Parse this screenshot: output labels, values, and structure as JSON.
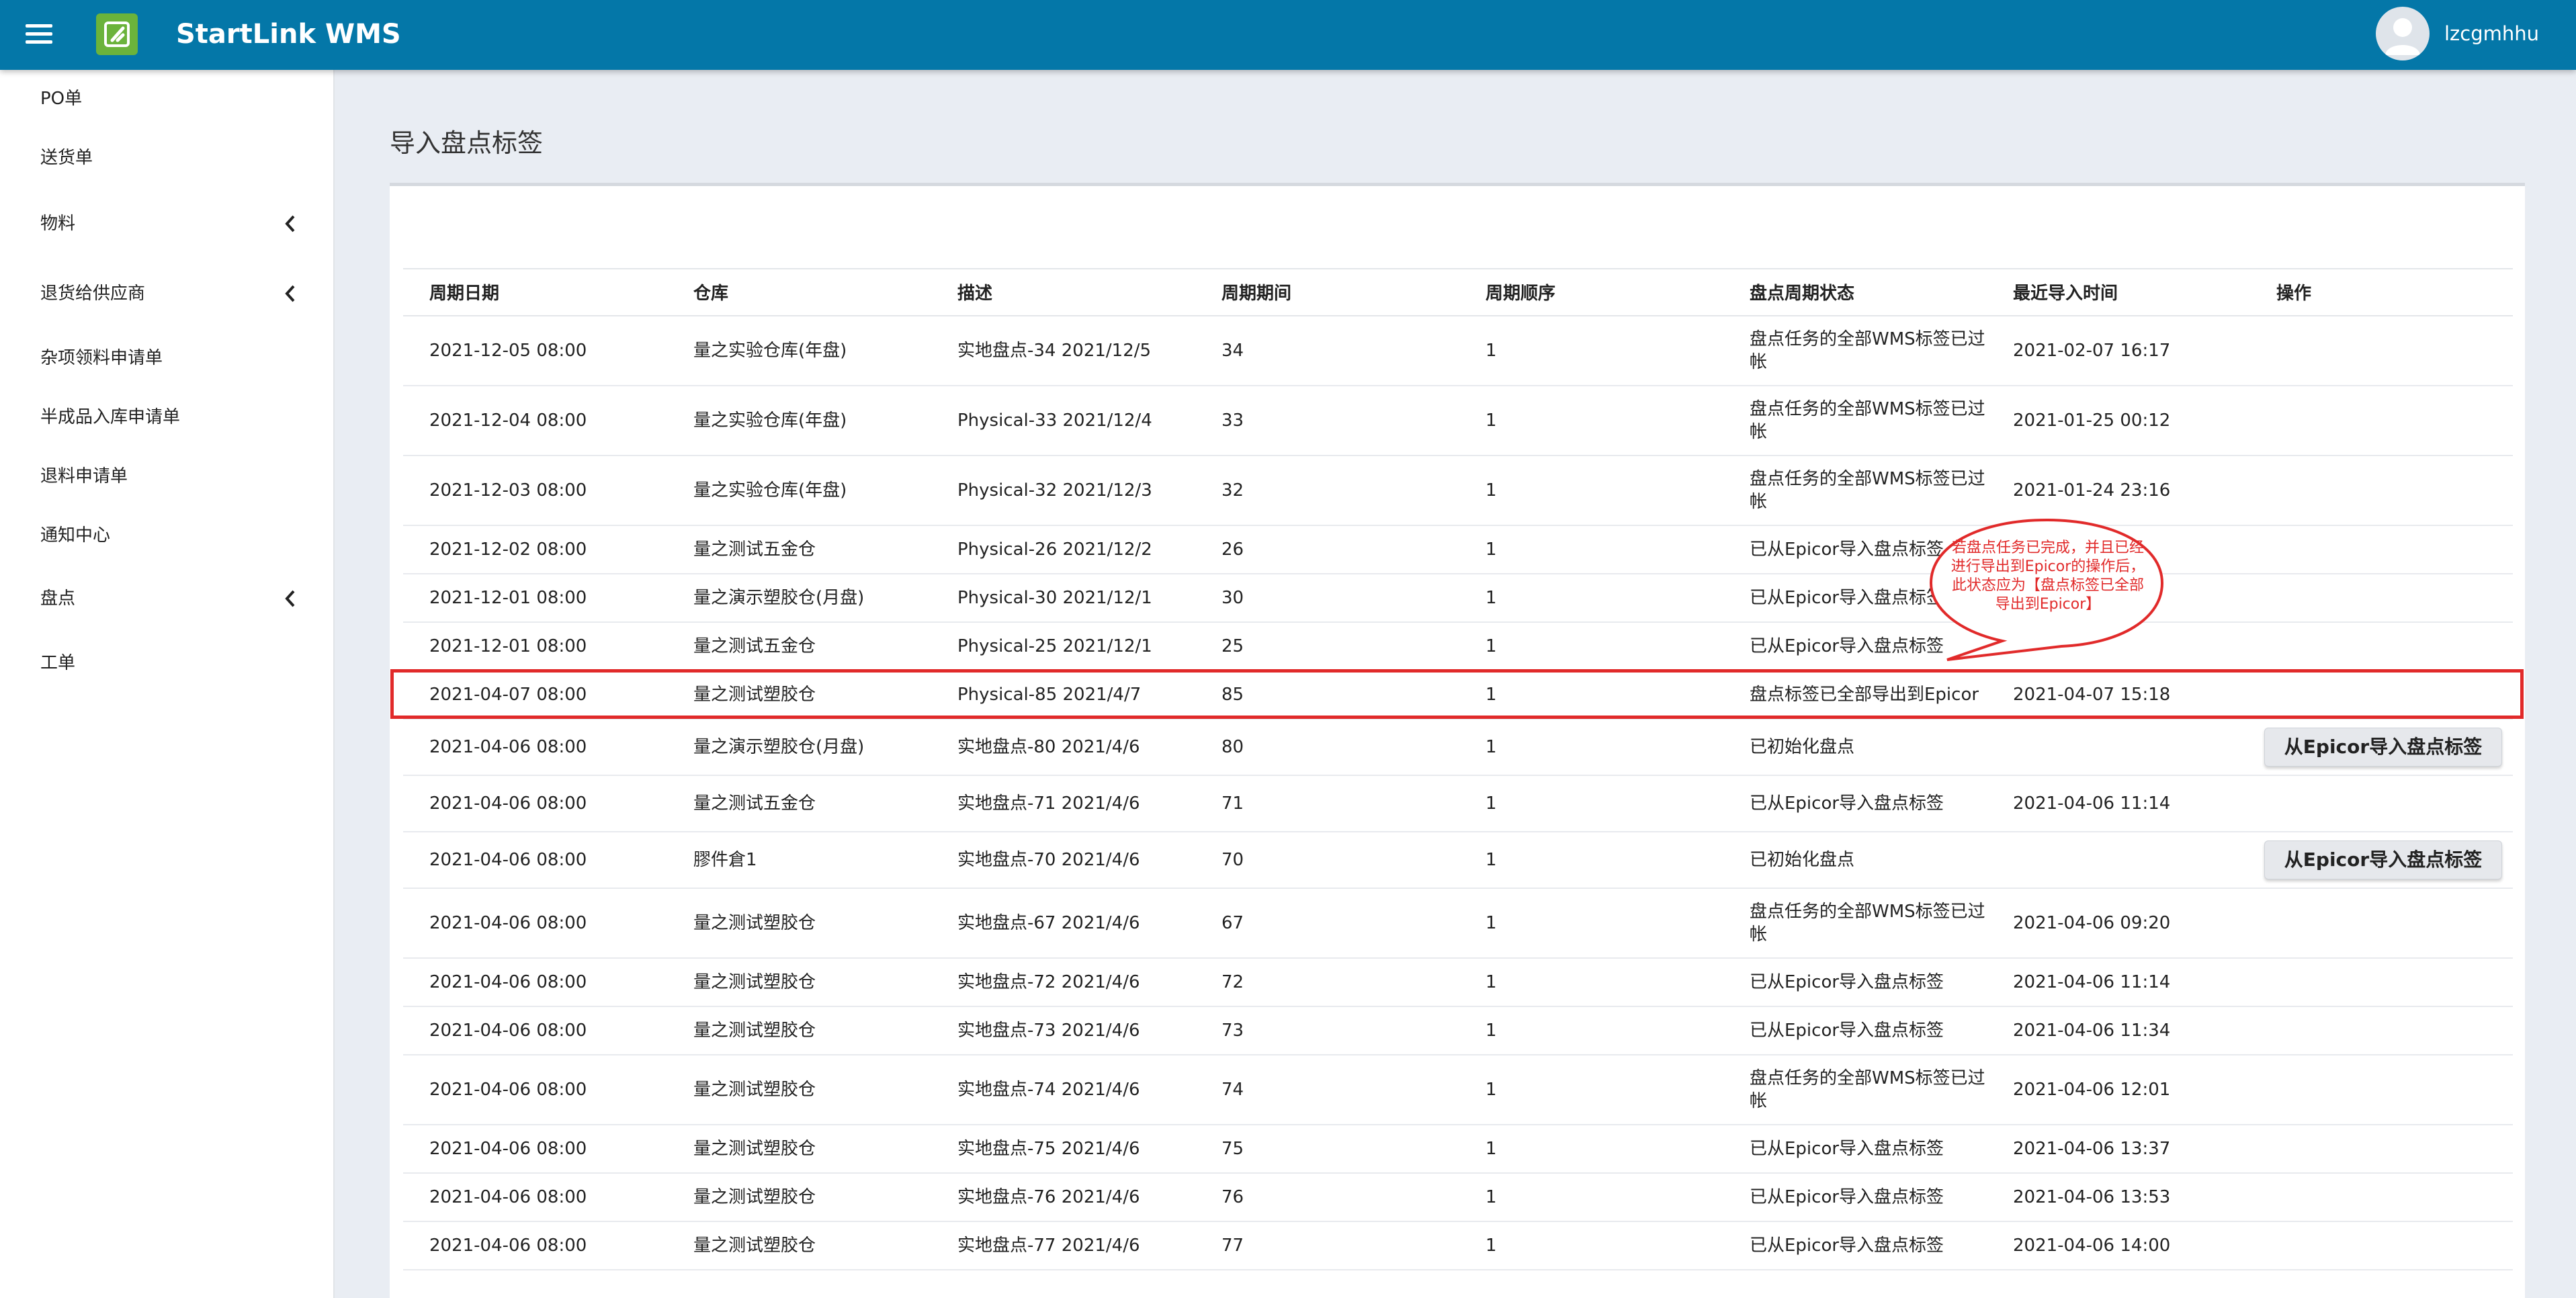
{
  "header": {
    "app_title": "StartLink WMS",
    "username": "lzcgmhhu"
  },
  "sidebar": {
    "items": [
      {
        "label": "PO单",
        "has_chevron": false
      },
      {
        "label": "送货单",
        "has_chevron": false
      },
      {
        "label": "物料",
        "has_chevron": true
      },
      {
        "label": "退货给供应商",
        "has_chevron": true
      },
      {
        "label": "杂项领料申请单",
        "has_chevron": false
      },
      {
        "label": "半成品入库申请单",
        "has_chevron": false
      },
      {
        "label": "退料申请单",
        "has_chevron": false
      },
      {
        "label": "通知中心",
        "has_chevron": false
      },
      {
        "label": "盘点",
        "has_chevron": true
      },
      {
        "label": "工单",
        "has_chevron": false
      }
    ]
  },
  "page": {
    "title": "导入盘点标签"
  },
  "table": {
    "columns": [
      "周期日期",
      "仓库",
      "描述",
      "周期期间",
      "周期顺序",
      "盘点周期状态",
      "最近导入时间",
      "操作"
    ],
    "rows": [
      {
        "date": "2021-12-05 08:00",
        "warehouse": "量之实验仓库(年盘)",
        "desc": "实地盘点-34 2021/12/5",
        "period": "34",
        "seq": "1",
        "status": "盘点任务的全部WMS标签已过帐",
        "imported": "2021-02-07 16:17",
        "action": ""
      },
      {
        "date": "2021-12-04 08:00",
        "warehouse": "量之实验仓库(年盘)",
        "desc": "Physical-33 2021/12/4",
        "period": "33",
        "seq": "1",
        "status": "盘点任务的全部WMS标签已过帐",
        "imported": "2021-01-25 00:12",
        "action": ""
      },
      {
        "date": "2021-12-03 08:00",
        "warehouse": "量之实验仓库(年盘)",
        "desc": "Physical-32 2021/12/3",
        "period": "32",
        "seq": "1",
        "status": "盘点任务的全部WMS标签已过帐",
        "imported": "2021-01-24 23:16",
        "action": ""
      },
      {
        "date": "2021-12-02 08:00",
        "warehouse": "量之测试五金仓",
        "desc": "Physical-26 2021/12/2",
        "period": "26",
        "seq": "1",
        "status": "已从Epicor导入盘点标签",
        "imported": "",
        "action": ""
      },
      {
        "date": "2021-12-01 08:00",
        "warehouse": "量之演示塑胶仓(月盘)",
        "desc": "Physical-30 2021/12/1",
        "period": "30",
        "seq": "1",
        "status": "已从Epicor导入盘点标签",
        "imported": "",
        "action": ""
      },
      {
        "date": "2021-12-01 08:00",
        "warehouse": "量之测试五金仓",
        "desc": "Physical-25 2021/12/1",
        "period": "25",
        "seq": "1",
        "status": "已从Epicor导入盘点标签",
        "imported": "",
        "action": ""
      },
      {
        "date": "2021-04-07 08:00",
        "warehouse": "量之测试塑胶仓",
        "desc": "Physical-85 2021/4/7",
        "period": "85",
        "seq": "1",
        "status": "盘点标签已全部导出到Epicor",
        "imported": "2021-04-07 15:18",
        "action": ""
      },
      {
        "date": "2021-04-06 08:00",
        "warehouse": "量之演示塑胶仓(月盘)",
        "desc": "实地盘点-80 2021/4/6",
        "period": "80",
        "seq": "1",
        "status": "已初始化盘点",
        "imported": "",
        "action": "从Epicor导入盘点标签"
      },
      {
        "date": "2021-04-06 08:00",
        "warehouse": "量之测试五金仓",
        "desc": "实地盘点-71 2021/4/6",
        "period": "71",
        "seq": "1",
        "status": "已从Epicor导入盘点标签",
        "imported": "2021-04-06 11:14",
        "action": ""
      },
      {
        "date": "2021-04-06 08:00",
        "warehouse": "膠件倉1",
        "desc": "实地盘点-70 2021/4/6",
        "period": "70",
        "seq": "1",
        "status": "已初始化盘点",
        "imported": "",
        "action": "从Epicor导入盘点标签"
      },
      {
        "date": "2021-04-06 08:00",
        "warehouse": "量之测试塑胶仓",
        "desc": "实地盘点-67 2021/4/6",
        "period": "67",
        "seq": "1",
        "status": "盘点任务的全部WMS标签已过帐",
        "imported": "2021-04-06 09:20",
        "action": ""
      },
      {
        "date": "2021-04-06 08:00",
        "warehouse": "量之测试塑胶仓",
        "desc": "实地盘点-72 2021/4/6",
        "period": "72",
        "seq": "1",
        "status": "已从Epicor导入盘点标签",
        "imported": "2021-04-06 11:14",
        "action": ""
      },
      {
        "date": "2021-04-06 08:00",
        "warehouse": "量之测试塑胶仓",
        "desc": "实地盘点-73 2021/4/6",
        "period": "73",
        "seq": "1",
        "status": "已从Epicor导入盘点标签",
        "imported": "2021-04-06 11:34",
        "action": ""
      },
      {
        "date": "2021-04-06 08:00",
        "warehouse": "量之测试塑胶仓",
        "desc": "实地盘点-74 2021/4/6",
        "period": "74",
        "seq": "1",
        "status": "盘点任务的全部WMS标签已过帐",
        "imported": "2021-04-06 12:01",
        "action": ""
      },
      {
        "date": "2021-04-06 08:00",
        "warehouse": "量之测试塑胶仓",
        "desc": "实地盘点-75 2021/4/6",
        "period": "75",
        "seq": "1",
        "status": "已从Epicor导入盘点标签",
        "imported": "2021-04-06 13:37",
        "action": ""
      },
      {
        "date": "2021-04-06 08:00",
        "warehouse": "量之测试塑胶仓",
        "desc": "实地盘点-76 2021/4/6",
        "period": "76",
        "seq": "1",
        "status": "已从Epicor导入盘点标签",
        "imported": "2021-04-06 13:53",
        "action": ""
      },
      {
        "date": "2021-04-06 08:00",
        "warehouse": "量之测试塑胶仓",
        "desc": "实地盘点-77 2021/4/6",
        "period": "77",
        "seq": "1",
        "status": "已从Epicor导入盘点标签",
        "imported": "2021-04-06 14:00",
        "action": ""
      }
    ]
  },
  "annotation": {
    "text": "若盘点任务已完成，并且已经进行导出到Epicor的操作后，此状态应为【盘点标签已全部导出到Epicor】"
  },
  "colors": {
    "header_bg": "#0477a8",
    "logo_green": "#6bb33b",
    "annotation_red": "#e12a2a"
  }
}
